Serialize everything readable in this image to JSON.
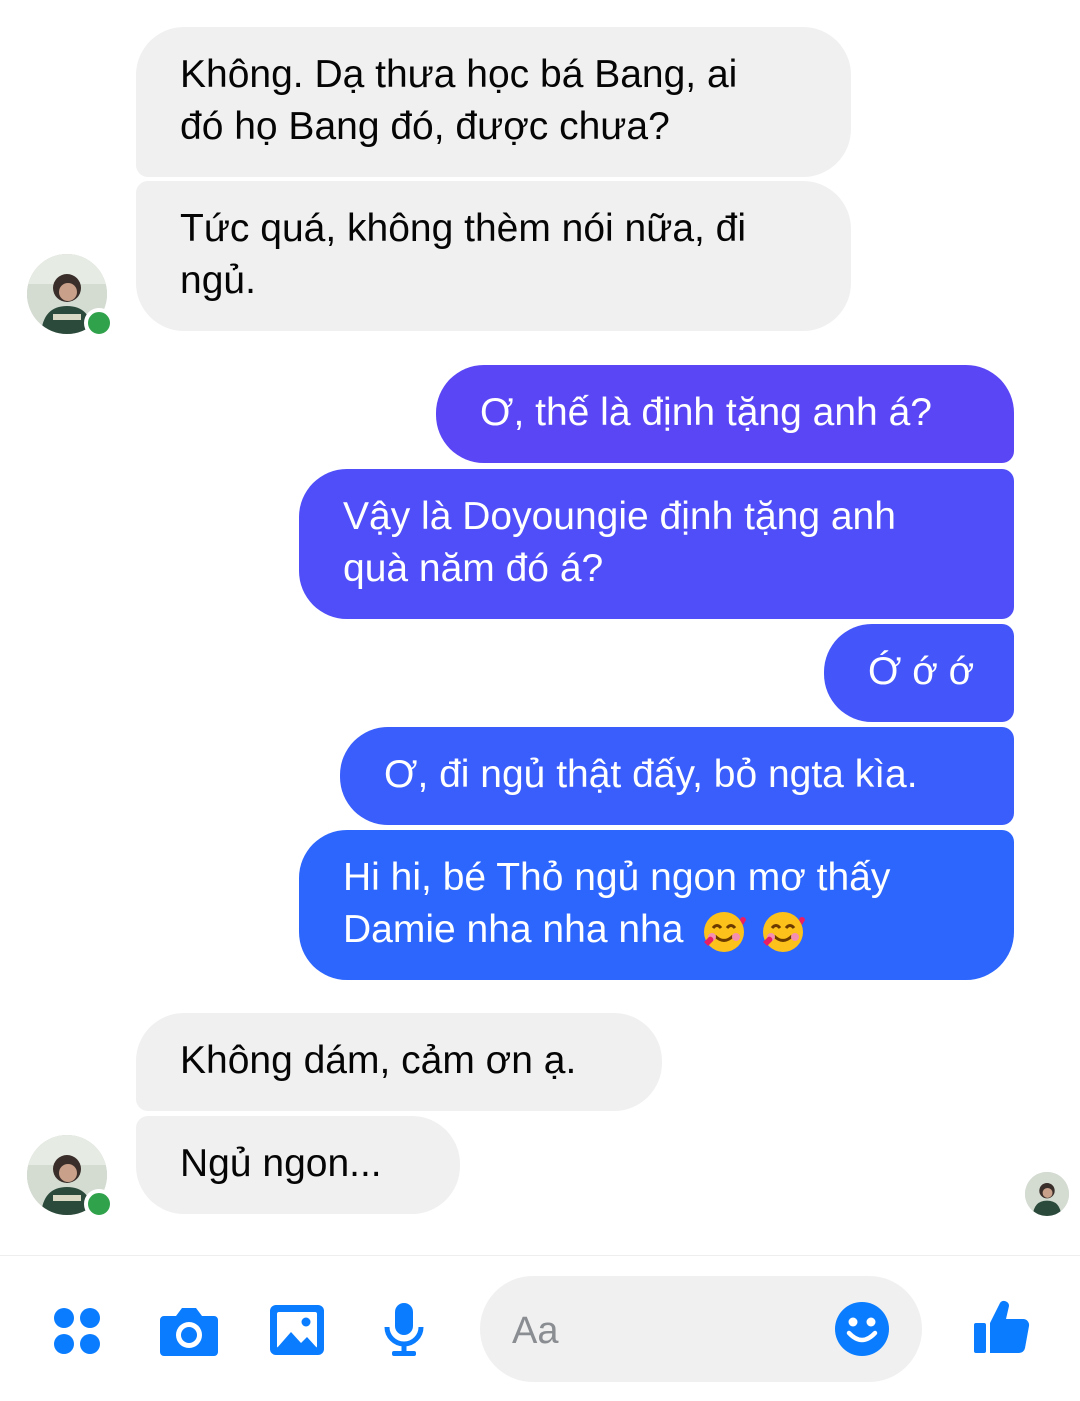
{
  "colors": {
    "accent": "#0a7cff",
    "incoming_bubble": "#f0f0f0",
    "outgoing_gradient_top": "#5b45f5",
    "outgoing_gradient_bottom": "#1a6dff",
    "online": "#31a24c"
  },
  "messages": {
    "in1": "Không. Dạ thưa học bá Bang, ai",
    "in1b": "đó họ Bang đó, được chưa?",
    "in2": "Tức quá, không thèm nói nữa, đi",
    "in2b": "ngủ.",
    "out1": "Ơ, thế là định tặng anh á?",
    "out2": "Vậy là Doyoungie định tặng anh",
    "out2b": "quà năm đó á?",
    "out3": "Ớ ớ ớ",
    "out4": "Ơ, đi ngủ thật đấy, bỏ ngta kìa.",
    "out5": "Hi hi, bé Thỏ ngủ ngon mơ thấy",
    "out5b": "Damie nha nha nha",
    "in3": "Không dám, cảm ơn ạ.",
    "in4": "Ngủ ngon..."
  },
  "emoji": [
    "smiling-face-with-hearts",
    "smiling-face-with-hearts"
  ],
  "composer": {
    "placeholder": "Aa",
    "icons": [
      "menu-dots-icon",
      "camera-icon",
      "image-icon",
      "microphone-icon",
      "emoji-icon",
      "thumbs-up-icon"
    ]
  }
}
